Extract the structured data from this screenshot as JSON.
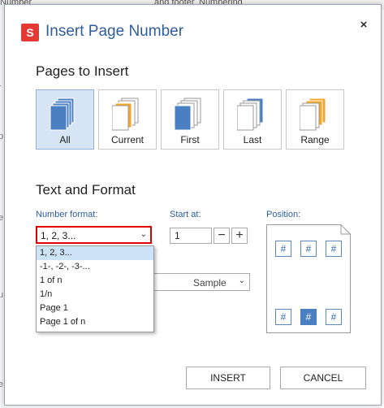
{
  "background": {
    "strip_texts": [
      "Number",
      "and footer",
      "Numbering"
    ],
    "left_glyphs": [
      "r",
      "p",
      "e",
      "u",
      "e"
    ]
  },
  "dialog": {
    "logo_letter": "S",
    "title": "Insert Page Number",
    "close_glyph": "×"
  },
  "pages_section": {
    "title": "Pages to Insert",
    "options": [
      {
        "label": "All",
        "selected": true
      },
      {
        "label": "Current",
        "selected": false
      },
      {
        "label": "First",
        "selected": false
      },
      {
        "label": "Last",
        "selected": false
      },
      {
        "label": "Range",
        "selected": false
      }
    ]
  },
  "format_section": {
    "title": "Text and Format",
    "number_format_label": "Number format:",
    "number_format_value": "1, 2, 3...",
    "number_format_options": [
      "1, 2, 3...",
      "-1-, -2-, -3-...",
      "1 of n",
      "1/n",
      "Page 1",
      "Page 1 of n"
    ],
    "start_at_label": "Start at:",
    "start_at_value": "1",
    "minus_glyph": "−",
    "plus_glyph": "+",
    "position_label": "Position:",
    "position_glyph": "#",
    "sample_value": "Sample"
  },
  "buttons": {
    "insert": "INSERT",
    "cancel": "CANCEL"
  },
  "colors": {
    "accent": "#2f5e9e",
    "logo": "#e53935",
    "selected_bg": "#d7e4f3",
    "highlight_border": "#e00000",
    "page_blue": "#4a7fc1",
    "page_orange": "#f5a623"
  }
}
